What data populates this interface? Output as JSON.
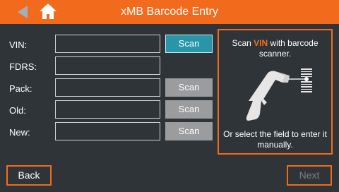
{
  "header": {
    "title": "xMB Barcode Entry",
    "accent_color": "#f26b1d",
    "back_icon": "back-arrow-icon",
    "home_icon": "home-icon"
  },
  "form": {
    "rows": [
      {
        "label": "VIN:",
        "value": "",
        "scan_label": "Scan",
        "scan_active": true
      },
      {
        "label": "FDRS:",
        "value": ""
      },
      {
        "label": "Pack:",
        "value": "",
        "scan_label": "Scan",
        "scan_active": false
      },
      {
        "label": "Old:",
        "value": "",
        "scan_label": "Scan",
        "scan_active": false
      },
      {
        "label": "New:",
        "value": "",
        "scan_label": "Scan",
        "scan_active": false
      }
    ]
  },
  "panel": {
    "text_before": "Scan ",
    "highlight": "VIN",
    "text_after": " with barcode scanner.",
    "bottom_text": "Or select the field to enter it manually.",
    "icon": "barcode-scanner-icon"
  },
  "footer": {
    "back_label": "Back",
    "next_label": "Next"
  }
}
